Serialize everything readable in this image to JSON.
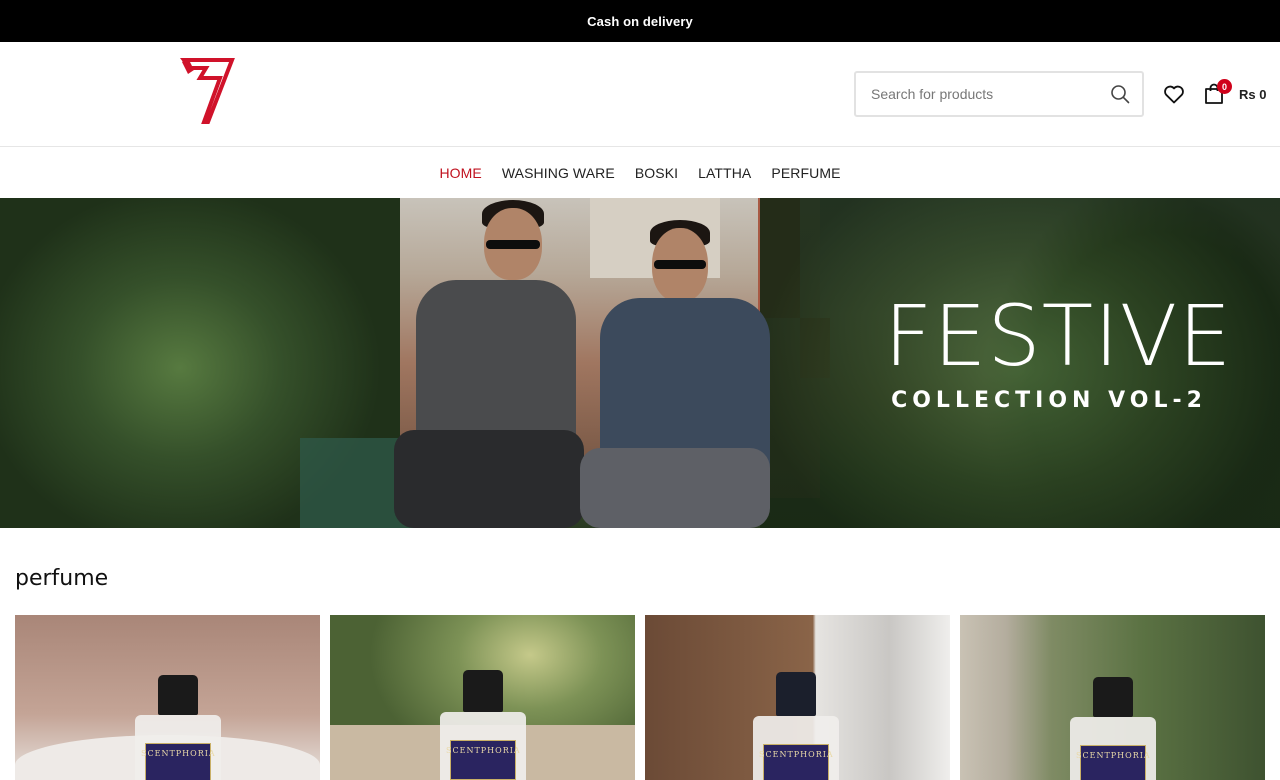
{
  "topbar": {
    "text": "Cash on delivery"
  },
  "header": {
    "logo": "brand-logo",
    "search": {
      "placeholder": "Search for products",
      "value": ""
    },
    "cart": {
      "count": "0",
      "total": "Rs 0"
    }
  },
  "nav": {
    "items": [
      {
        "label": "HOME",
        "active": true
      },
      {
        "label": "WASHING WARE",
        "active": false
      },
      {
        "label": "BOSKI",
        "active": false
      },
      {
        "label": "LATTHA",
        "active": false
      },
      {
        "label": "PERFUME",
        "active": false
      }
    ]
  },
  "hero": {
    "title": "FESTIVE",
    "subtitle": "COLLECTION VOL-2"
  },
  "section": {
    "title": "perfume"
  },
  "products": [
    {
      "label_text": "SCENTPHORIA",
      "bg": "#b89787"
    },
    {
      "label_text": "SCENTPHORIA",
      "bg": "#7e8f5a"
    },
    {
      "label_text": "SCENTPHORIA",
      "bg": "#9c7a5c"
    },
    {
      "label_text": "SCENTPHORIA",
      "bg": "#6f7e5a"
    }
  ],
  "colors": {
    "accent": "#c0121f",
    "topbar": "#000000",
    "badge": "#d0021b"
  },
  "icons": [
    "search-icon",
    "heart-icon",
    "cart-icon"
  ]
}
